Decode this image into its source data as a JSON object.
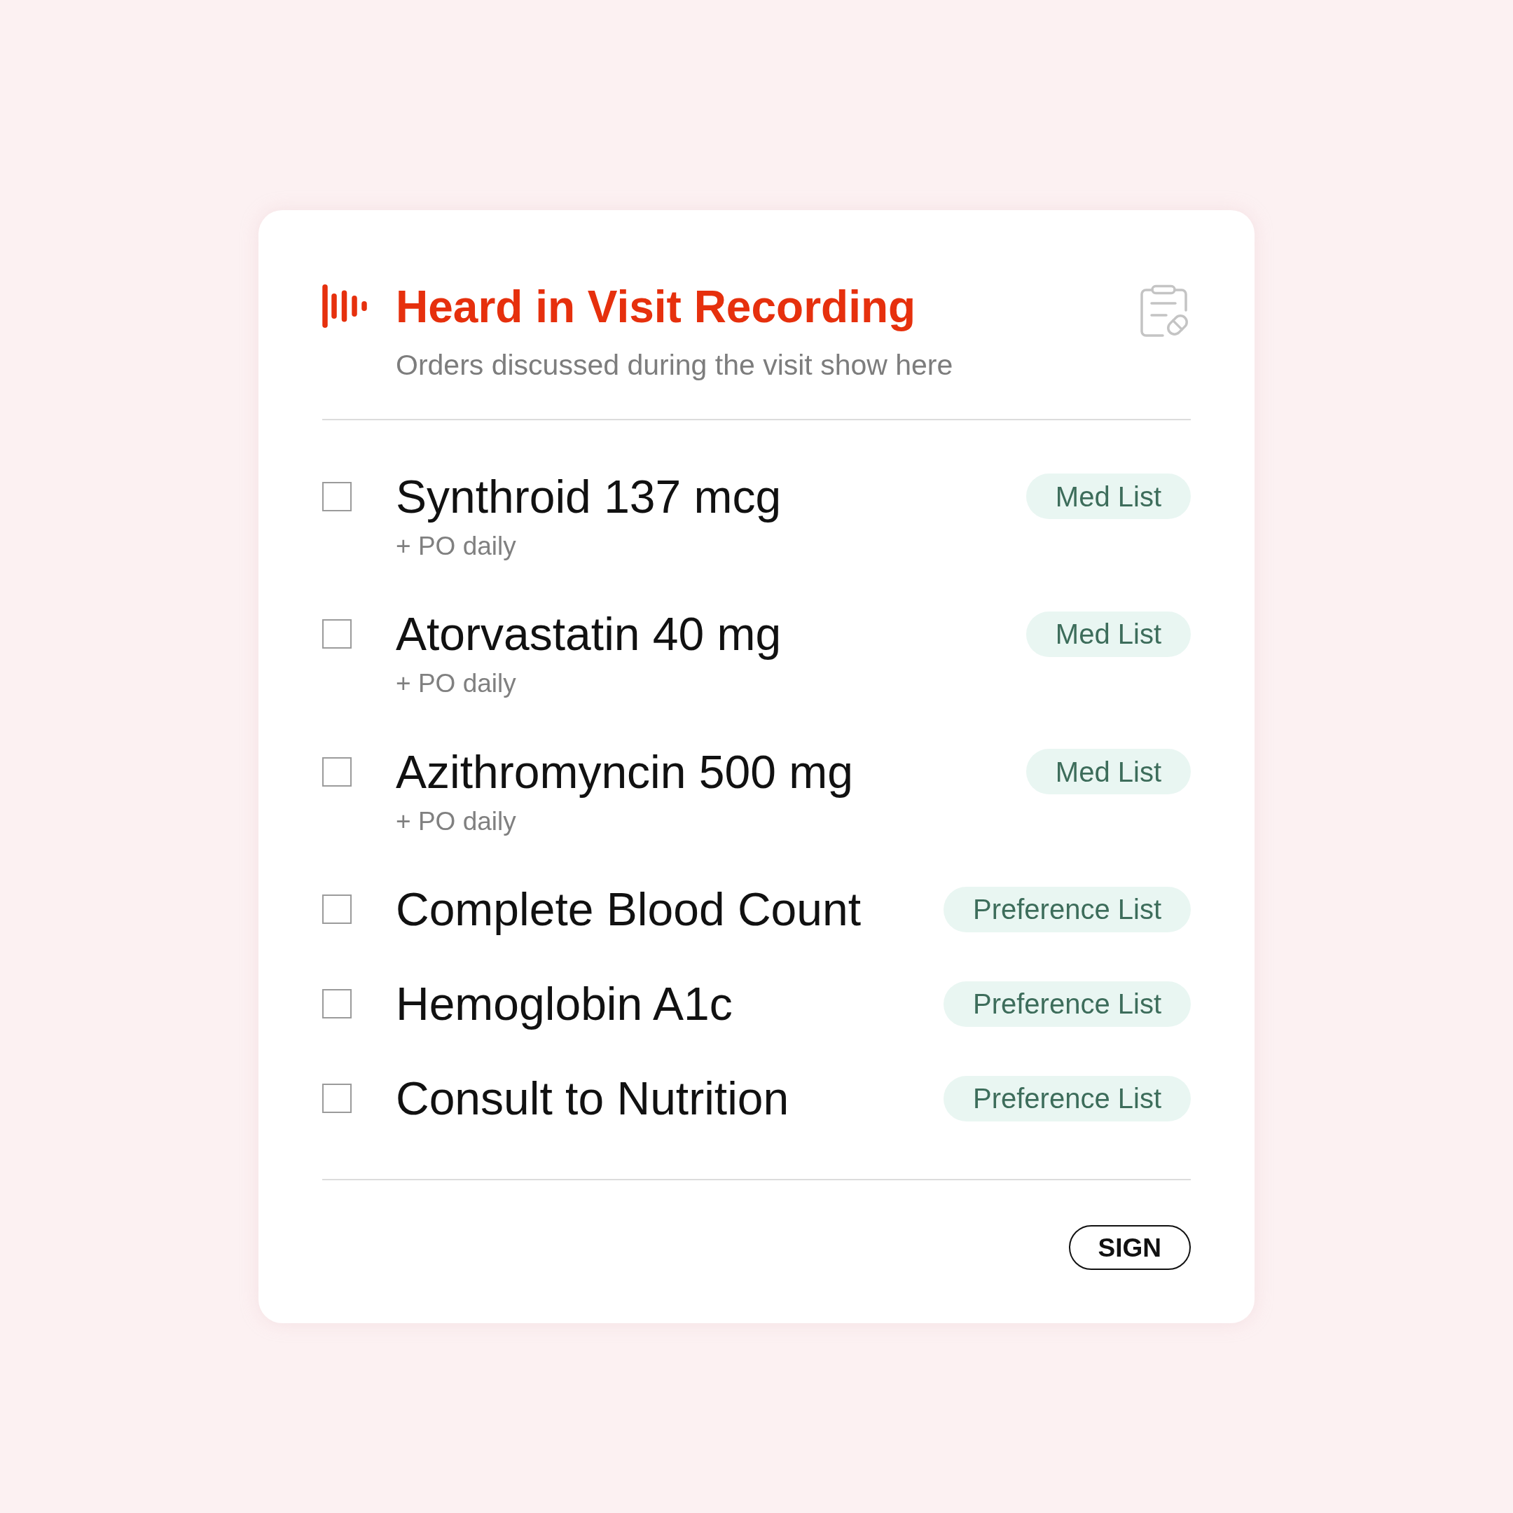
{
  "header": {
    "title": "Heard in Visit Recording",
    "subtitle": "Orders discussed during the visit show here"
  },
  "orders": [
    {
      "name": "Synthroid 137 mcg",
      "detail": "+ PO daily",
      "checked": false,
      "tag": "Med List"
    },
    {
      "name": "Atorvastatin 40 mg",
      "detail": "+ PO daily",
      "checked": false,
      "tag": "Med List"
    },
    {
      "name": "Azithromyncin 500 mg",
      "detail": "+ PO daily",
      "checked": false,
      "tag": "Med List"
    },
    {
      "name": "Complete Blood Count",
      "checked": false,
      "tag": "Preference List"
    },
    {
      "name": "Hemoglobin A1c",
      "checked": false,
      "tag": "Preference List"
    },
    {
      "name": "Consult to Nutrition",
      "checked": false,
      "tag": "Preference List"
    }
  ],
  "footer": {
    "button": "SIGN"
  }
}
